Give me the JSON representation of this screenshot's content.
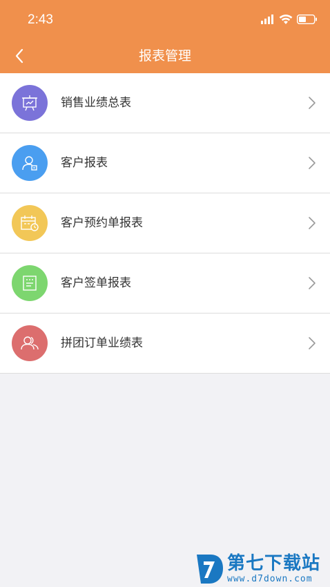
{
  "status_bar": {
    "time": "2:43",
    "icons": [
      "signal-icon",
      "wifi-icon",
      "battery-icon"
    ]
  },
  "nav": {
    "title": "报表管理",
    "back_icon": "chevron-left-icon"
  },
  "colors": {
    "header": "#f0904c",
    "background": "#f2f2f5"
  },
  "menu": [
    {
      "label": "销售业绩总表",
      "icon": "chart-board-icon",
      "color": "#7b73d9"
    },
    {
      "label": "客户报表",
      "icon": "user-card-icon",
      "color": "#4a9ef0"
    },
    {
      "label": "客户预约单报表",
      "icon": "calendar-clock-icon",
      "color": "#f2c757"
    },
    {
      "label": "客户签单报表",
      "icon": "document-icon",
      "color": "#7dd66f"
    },
    {
      "label": "拼团订单业绩表",
      "icon": "group-icon",
      "color": "#dc6e6e"
    }
  ],
  "watermark": {
    "title": "第七下载站",
    "url": "www.d7down.com"
  }
}
